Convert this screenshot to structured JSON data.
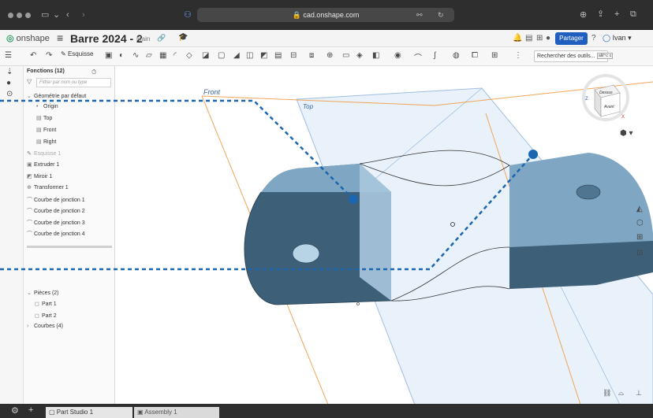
{
  "browser": {
    "url": "cad.onshape.com"
  },
  "app": {
    "logo": "onshape",
    "title": "Barre 2024 - 2",
    "branch": "Main",
    "share_label": "Partager",
    "user": "Ivan"
  },
  "toolbar": {
    "sketch_label": "Esquisse",
    "search_placeholder": "Rechercher des outils...",
    "search_shortcut": "alt/⌥ c"
  },
  "panel": {
    "header": "Fonctions (12)",
    "filter_placeholder": "Filtrer par nom ou type",
    "default_geometry": "Géométrie par défaut",
    "geometry": [
      "Origin",
      "Top",
      "Front",
      "Right"
    ],
    "features": [
      "Esquisse 1",
      "Extruder 1",
      "Miroir 1",
      "Transformer 1",
      "Courbe de jonction 1",
      "Courbe de jonction 2",
      "Courbe de jonction 3",
      "Courbe de jonction 4"
    ],
    "parts_header": "Pièces (2)",
    "parts": [
      "Part 1",
      "Part 2"
    ],
    "curves_header": "Courbes (4)"
  },
  "viewport": {
    "plane_front": "Front",
    "plane_top": "Top",
    "viewcube_top": "Dessus",
    "viewcube_front": "Avant",
    "viewcube_axes": [
      "Z",
      "X"
    ]
  },
  "tabs": [
    "Part Studio 1",
    "Assembly 1"
  ],
  "colors": {
    "part_face_dark": "#3d5f78",
    "part_face_light": "#8fb3cc",
    "plane_top": "#9fbfe3",
    "plane_front_outline": "#f2a55a",
    "dash_line": "#1a66b0",
    "accent": "#1f5fbf"
  }
}
